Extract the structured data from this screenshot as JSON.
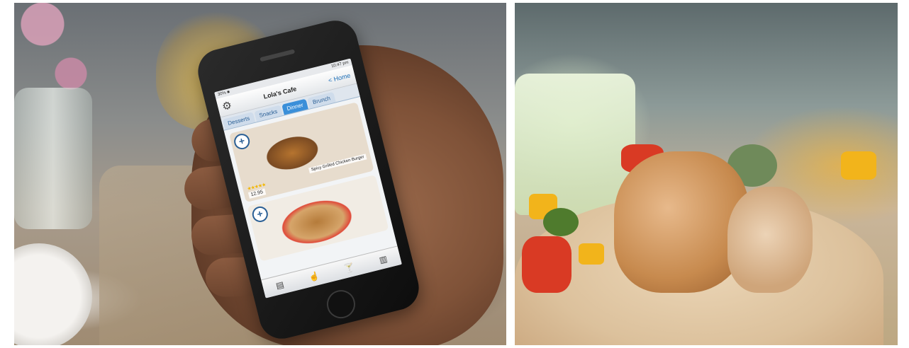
{
  "app": {
    "status_time": "10:47 pm",
    "status_carrier": "30% ■",
    "nav": {
      "home_link": "< Home",
      "title": "Lola's Cafe"
    },
    "tabs": [
      {
        "label": "Brunch"
      },
      {
        "label": "Dinner"
      },
      {
        "label": "Snacks"
      },
      {
        "label": "Desserts"
      }
    ],
    "menu_items": [
      {
        "name": "Spicy Grilled Chicken Burger",
        "price": "12.95",
        "rating_stars": 5
      }
    ]
  },
  "icons": {
    "settings": "gear-icon",
    "add": "plus-icon",
    "toolbar": [
      "menu-icon",
      "hand-icon",
      "drink-icon",
      "receipt-icon"
    ]
  }
}
